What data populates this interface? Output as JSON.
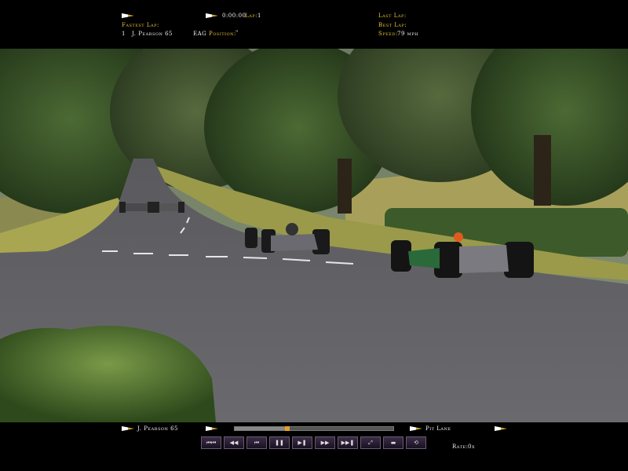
{
  "hud_top": {
    "timer": "0:00:00",
    "lap_label": "Lap:",
    "lap_value": "1",
    "fastest_lap_label": "Fastest Lap:",
    "fastest_pos": "1",
    "fastest_driver": "J. Pearson 65",
    "fastest_team": "EAG",
    "position_label": "Position:",
    "position_value": "\"",
    "last_lap_label": "Last Lap:",
    "best_lap_label": "Best Lap:",
    "speed_label": "Speed:",
    "speed_value": "79 mph"
  },
  "hud_bottom": {
    "driver": "J. Pearson 65",
    "location": "Pit Lane",
    "rate_label": "Rate:",
    "rate_value": "0x",
    "progress": 0.33,
    "controls": [
      "⏮⏮",
      "◀◀",
      "⏮",
      "❚❚",
      "▶❚",
      "▶▶",
      "▶▶❚",
      "⤢",
      "▬",
      "⟲"
    ]
  },
  "colors": {
    "hud_gold": "#e8c23c",
    "hud_white": "#f2f2f2",
    "button_bg": "#2a1e34"
  }
}
